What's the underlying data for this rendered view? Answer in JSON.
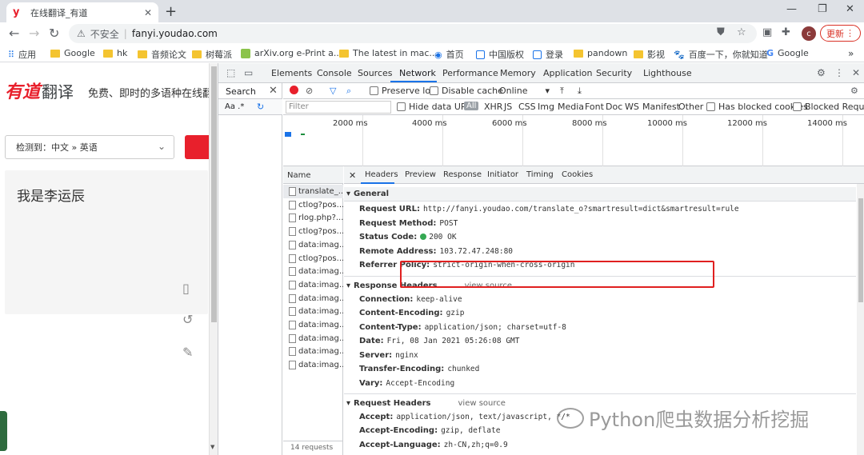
{
  "browser": {
    "tab_title": "在线翻译_有道",
    "tab_favicon": "y",
    "insecure_label": "不安全",
    "url": "fanyi.youdao.com",
    "avatar": "c",
    "update_label": "更新",
    "bookmarks": [
      {
        "icon": "apps-icon",
        "label": "应用"
      },
      {
        "icon": "folder-icon",
        "label": "Google"
      },
      {
        "icon": "folder-icon",
        "label": "hk"
      },
      {
        "icon": "folder-icon",
        "label": "音频论文"
      },
      {
        "icon": "folder-icon",
        "label": "树莓派"
      },
      {
        "icon": "arxiv-icon",
        "label": "arXiv.org e-Print a..."
      },
      {
        "icon": "folder-icon",
        "label": "The latest in mac..."
      },
      {
        "icon": "globe-icon",
        "label": "首页"
      },
      {
        "icon": "site-icon",
        "label": "中国版权"
      },
      {
        "icon": "site-icon",
        "label": "登录"
      },
      {
        "icon": "folder-icon",
        "label": "pandown"
      },
      {
        "icon": "folder-icon",
        "label": "影视"
      },
      {
        "icon": "baidu-icon",
        "label": "百度一下，你就知道"
      },
      {
        "icon": "google-icon",
        "label": "Google"
      }
    ]
  },
  "youdao": {
    "logo_a": "有道",
    "logo_b": "翻译",
    "slogan": "免费、即时的多语种在线翻",
    "lang_select": "检测到：中文 » 英语",
    "input_text": "我是李运辰"
  },
  "devtools": {
    "tabs": [
      "Elements",
      "Console",
      "Sources",
      "Network",
      "Performance",
      "Memory",
      "Application",
      "Security",
      "Lighthouse"
    ],
    "active_tab": "Network",
    "search_label": "Search",
    "search_opts": "Aa  .*",
    "preserve_log": "Preserve log",
    "disable_cache": "Disable cache",
    "throttle": "Online",
    "filter_placeholder": "Filter",
    "hide_data_urls": "Hide data URLs",
    "filter_types": [
      "All",
      "XHR",
      "JS",
      "CSS",
      "Img",
      "Media",
      "Font",
      "Doc",
      "WS",
      "Manifest",
      "Other"
    ],
    "has_blocked_cookies": "Has blocked cookies",
    "blocked_requests": "Blocked Requests",
    "timeline_ticks": [
      "2000 ms",
      "4000 ms",
      "6000 ms",
      "8000 ms",
      "10000 ms",
      "12000 ms",
      "14000 ms"
    ],
    "name_header": "Name",
    "requests": [
      "translate_...",
      "ctlog?pos...",
      "rlog.php?...",
      "ctlog?pos...",
      "data:imag...",
      "ctlog?pos...",
      "data:imag...",
      "data:imag...",
      "data:imag...",
      "data:imag...",
      "data:imag...",
      "data:imag...",
      "data:imag...",
      "data:imag..."
    ],
    "requests_count": "14 requests",
    "detail_tabs": [
      "Headers",
      "Preview",
      "Response",
      "Initiator",
      "Timing",
      "Cookies"
    ],
    "general": {
      "title": "General",
      "rows": [
        {
          "k": "Request URL:",
          "v": "http://fanyi.youdao.com/translate_o?smartresult=dict&smartresult=rule"
        },
        {
          "k": "Request Method:",
          "v": "POST"
        },
        {
          "k": "Status Code:",
          "v": "200 OK"
        },
        {
          "k": "Remote Address:",
          "v": "103.72.47.248:80"
        },
        {
          "k": "Referrer Policy:",
          "v": "strict-origin-when-cross-origin"
        }
      ]
    },
    "response_headers": {
      "title": "Response Headers",
      "view_source": "view source",
      "rows": [
        {
          "k": "Connection:",
          "v": "keep-alive"
        },
        {
          "k": "Content-Encoding:",
          "v": "gzip"
        },
        {
          "k": "Content-Type:",
          "v": "application/json; charset=utf-8"
        },
        {
          "k": "Date:",
          "v": "Fri, 08 Jan 2021 05:26:08 GMT"
        },
        {
          "k": "Server:",
          "v": "nginx"
        },
        {
          "k": "Transfer-Encoding:",
          "v": "chunked"
        },
        {
          "k": "Vary:",
          "v": "Accept-Encoding"
        }
      ]
    },
    "request_headers": {
      "title": "Request Headers",
      "view_source": "view source",
      "rows": [
        {
          "k": "Accept:",
          "v": "application/json, text/javascript, */*"
        },
        {
          "k": "Accept-Encoding:",
          "v": "gzip, deflate"
        },
        {
          "k": "Accept-Language:",
          "v": "zh-CN,zh;q=0.9"
        }
      ]
    }
  },
  "watermark": "Python爬虫数据分析挖掘"
}
